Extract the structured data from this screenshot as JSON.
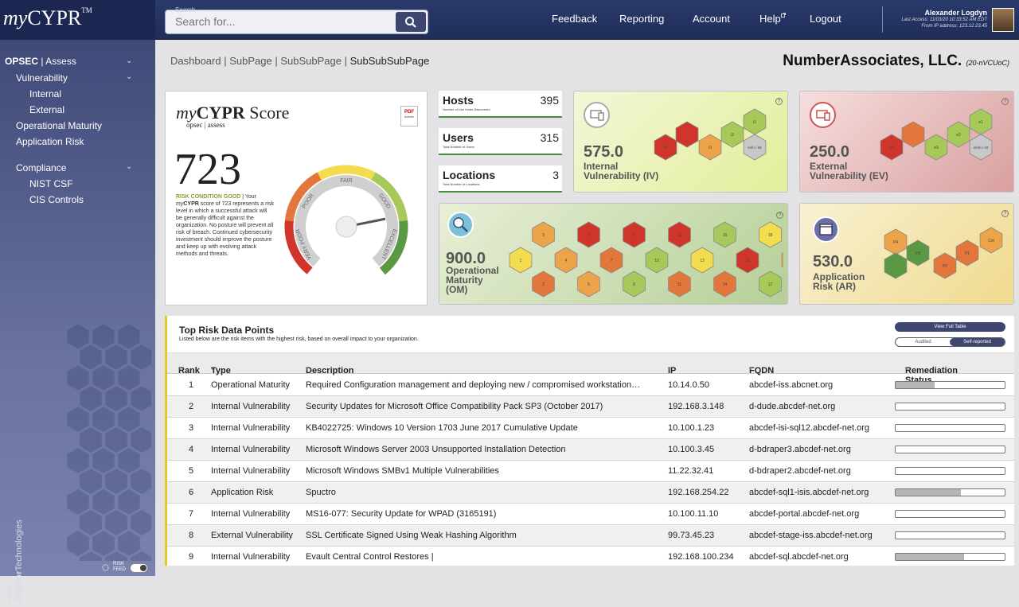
{
  "header": {
    "logo_prefix": "my",
    "logo_main": "CYPR",
    "logo_tm": "TM",
    "search": {
      "label": "Search",
      "placeholder": "Search for..."
    },
    "nav": [
      "Feedback",
      "Reporting",
      "Account",
      "Help",
      "Logout"
    ],
    "user": {
      "name": "Alexander Logdyn",
      "last_access": "Last Access: 11/03/20 10:33:52 AM EDT",
      "from_ip": "From IP address: 123.12.23.45"
    }
  },
  "sidebar": {
    "opsec": "OPSEC",
    "assess": "Assess",
    "items": [
      "Vulnerability",
      "Internal",
      "External",
      "Operational Maturity",
      "Application Risk",
      "Compliance",
      "NIST CSF",
      "CIS Controls"
    ],
    "powered_by": "Powered By",
    "powered_company": "Anchor",
    "powered_company2": "Technologies",
    "risk_feed": [
      "RISK",
      "FEED"
    ]
  },
  "breadcrumb": {
    "items": [
      "Dashboard",
      "SubPage",
      "SubSubPage"
    ],
    "current": "SubSubSubPage",
    "sep": " | "
  },
  "company": {
    "name": "NumberAssociates, LLC.",
    "code": "(20-nVCUoC)"
  },
  "score": {
    "title_prefix": "my",
    "title_main": "CYPR",
    "title_word": "Score",
    "subtitle": "opsec | assess",
    "pdf_label": "PDF",
    "pdf_sub": "Adobe",
    "value": "723",
    "condition": "RISK CONDITION GOOD",
    "desc_pre": " | Your ",
    "desc_my": "my",
    "desc_cypr": "CYPR",
    "desc": " score of 723 represents a risk level in which a successful attack will be generally difficult against the organization. No posture will prevent all risk of breach. Continued cybersecurity investment should improve the posture and keep up with evolving attack methods and threats.",
    "gauge_labels": [
      "VERY POOR",
      "POOR",
      "FAIR",
      "GOOD",
      "EXCELLENT"
    ],
    "gauge_fraction": 0.78
  },
  "stats": [
    {
      "title": "Hosts",
      "value": "395",
      "sub": "Number of Live Hosts Discovered"
    },
    {
      "title": "Users",
      "value": "315",
      "sub": "Total Number of Users"
    },
    {
      "title": "Locations",
      "value": "3",
      "sub": "Total Number of Locations"
    }
  ],
  "panels": {
    "iv": {
      "value": "575.0",
      "label1": "Internal",
      "label2": "Vulnerability (IV)",
      "hex_labels": [
        "i1",
        "i2",
        "i3",
        "i4",
        "iInfo / 68"
      ]
    },
    "ev": {
      "value": "250.0",
      "label1": "External",
      "label2": "Vulnerability (EV)",
      "hex_labels": [
        "e1",
        "e2",
        "e3",
        "e4",
        "eInfo / 18"
      ]
    },
    "om": {
      "value": "900.0",
      "label1": "Operational",
      "label2": "Maturity",
      "label3": "(OM)"
    },
    "ar": {
      "value": "530.0",
      "label1": "Application",
      "label2": "Risk (AR)",
      "hex_labels": [
        "P4",
        "P3",
        "P2",
        "P1",
        "Crit"
      ]
    }
  },
  "colors": {
    "red": "#d0352c",
    "orange": "#e3763a",
    "lorange": "#eda34a",
    "yellow": "#f4dc4f",
    "lgreen": "#a6c95a",
    "green": "#5b9843",
    "grey": "#c8c8c8"
  },
  "table": {
    "title": "Top Risk Data Points",
    "subtitle": "Listed below are the risk items with the highest risk, based on overall impact to your organization.",
    "view_full": "View Full Table",
    "toggle": [
      "Audited",
      "Self-reported"
    ],
    "columns": [
      "Rank",
      "Type",
      "Description",
      "IP",
      "FQDN",
      "Remediation Status"
    ],
    "rows": [
      {
        "rank": "1",
        "type": "Operational Maturity",
        "desc": "Required Configuration management and deploying new / compromised workstation…",
        "ip": "10.14.0.50",
        "fqdn": "abcdef-iss.abcnet.org",
        "rem": 0.36
      },
      {
        "rank": "2",
        "type": "Internal Vulnerability",
        "desc": "Security Updates for Microsoft Office Compatibility Pack SP3 (October 2017)",
        "ip": "192.168.3.148",
        "fqdn": "d-dude.abcdef-net.org",
        "rem": 0
      },
      {
        "rank": "3",
        "type": "Internal Vulnerability",
        "desc": "KB4022725: Windows 10 Version 1703 June 2017 Cumulative Update",
        "ip": "10.100.1.23",
        "fqdn": "abcdef-isi-sql12.abcdef-net.org",
        "rem": 0
      },
      {
        "rank": "4",
        "type": "Internal Vulnerability",
        "desc": "Microsoft Windows Server 2003 Unsupported Installation Detection",
        "ip": "10.100.3.45",
        "fqdn": "d-bdraper3.abcdef-net.org",
        "rem": 0
      },
      {
        "rank": "5",
        "type": "Internal Vulnerability",
        "desc": "Microsoft Windows SMBv1 Multiple Vulnerabilities",
        "ip": "11.22.32.41",
        "fqdn": "d-bdraper2.abcdef-net.org",
        "rem": 0
      },
      {
        "rank": "6",
        "type": "Application Risk",
        "desc": "Spuctro",
        "ip": "192.168.254.22",
        "fqdn": "abcdef-sql1-isis.abcdef-net.org",
        "rem": 0.6
      },
      {
        "rank": "7",
        "type": "Internal Vulnerability",
        "desc": "MS16-077: Security Update for WPAD (3165191)",
        "ip": "10.100.11.10",
        "fqdn": "abcdef-portal.abcdef-net.org",
        "rem": 0
      },
      {
        "rank": "8",
        "type": "External Vulnerability",
        "desc": "SSL Certificate Signed Using Weak Hashing Algorithm",
        "ip": "99.73.45.23",
        "fqdn": "abcdef-stage-iss.abcdef-net.org",
        "rem": 0
      },
      {
        "rank": "9",
        "type": "Internal Vulnerability",
        "desc": "Evault Central Control Restores |",
        "ip": "192.168.100.234",
        "fqdn": "abcdef-sql.abcdef-net.org",
        "rem": 0.63
      }
    ]
  }
}
